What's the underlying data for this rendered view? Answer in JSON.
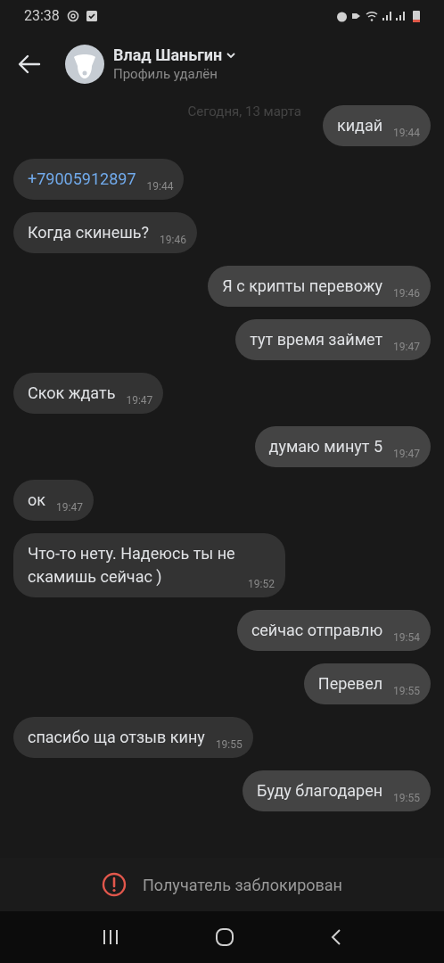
{
  "status_bar": {
    "time": "23:38"
  },
  "header": {
    "name": "Влад Шаньгин",
    "status": "Профиль удалён"
  },
  "date_separator": "Сегодня, 13 марта",
  "messages": [
    {
      "kind": "text",
      "outgoing": true,
      "text": "кидай",
      "time": "19:44"
    },
    {
      "kind": "link",
      "outgoing": false,
      "text": "+79005912897",
      "time": "19:44"
    },
    {
      "kind": "text",
      "outgoing": false,
      "text": "Когда скинешь?",
      "time": "19:46"
    },
    {
      "kind": "text",
      "outgoing": true,
      "text": "Я с крипты перевожу",
      "time": "19:46"
    },
    {
      "kind": "text",
      "outgoing": true,
      "text": "тут время займет",
      "time": "19:47"
    },
    {
      "kind": "text",
      "outgoing": false,
      "text": "Скок ждать",
      "time": "19:47"
    },
    {
      "kind": "text",
      "outgoing": true,
      "text": "думаю минут 5",
      "time": "19:47"
    },
    {
      "kind": "text",
      "outgoing": false,
      "text": "ок",
      "time": "19:47"
    },
    {
      "kind": "text",
      "outgoing": false,
      "text": "Что-то нету. Надеюсь ты не скамишь сейчас )",
      "time": "19:52"
    },
    {
      "kind": "text",
      "outgoing": true,
      "text": "сейчас отправлю",
      "time": "19:54"
    },
    {
      "kind": "text",
      "outgoing": true,
      "text": "Перевел",
      "time": "19:55"
    },
    {
      "kind": "text",
      "outgoing": false,
      "text": "спасибо ща отзыв кину",
      "time": "19:55"
    },
    {
      "kind": "text",
      "outgoing": true,
      "text": "Буду благодарен",
      "time": "19:55"
    }
  ],
  "blocked_notice": "Получатель заблокирован"
}
